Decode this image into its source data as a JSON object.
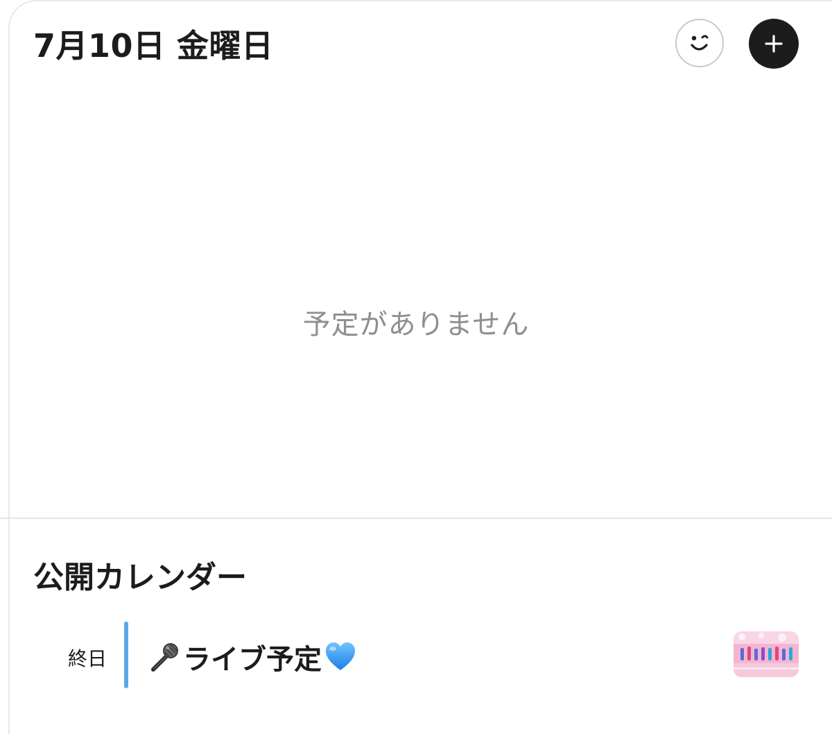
{
  "header": {
    "date_title": "7月10日 金曜日",
    "face_icon": "smiley-wink-icon",
    "add_icon": "plus-icon"
  },
  "main": {
    "empty_message": "予定がありません"
  },
  "public_calendar": {
    "title": "公開カレンダー",
    "events": [
      {
        "time_label": "終日",
        "prefix_icon": "microphone-icon",
        "title": "ライブ予定",
        "suffix_icon": "blue-heart-icon",
        "bar_color": "#5aa7e8",
        "thumbnail_icon": "calendar-thumbnail-image"
      }
    ]
  },
  "colors": {
    "text_primary": "#1c1c1e",
    "text_secondary": "#8e8e93",
    "accent_bar": "#5aa7e8",
    "add_button_bg": "#1c1c1c"
  }
}
